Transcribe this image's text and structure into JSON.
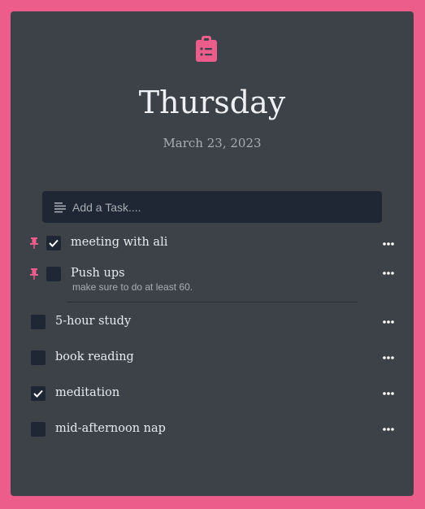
{
  "header": {
    "icon": "clipboard-list-icon",
    "day": "Thursday",
    "date": "March 23, 2023"
  },
  "add_task": {
    "icon": "text-lines-icon",
    "placeholder": "Add a Task...."
  },
  "colors": {
    "background": "#ec5d8c",
    "card": "#3d4249",
    "input": "#1f2734",
    "accent": "#ec5d8c"
  },
  "tasks": [
    {
      "label": "meeting with ali",
      "checked": true,
      "pinned": true,
      "note": ""
    },
    {
      "label": "Push ups",
      "checked": false,
      "pinned": true,
      "note": "make sure to do at least 60."
    },
    {
      "label": "5-hour study",
      "checked": false,
      "pinned": false,
      "note": ""
    },
    {
      "label": "book reading",
      "checked": false,
      "pinned": false,
      "note": ""
    },
    {
      "label": "meditation",
      "checked": true,
      "pinned": false,
      "note": ""
    },
    {
      "label": "mid-afternoon nap",
      "checked": false,
      "pinned": false,
      "note": ""
    }
  ]
}
